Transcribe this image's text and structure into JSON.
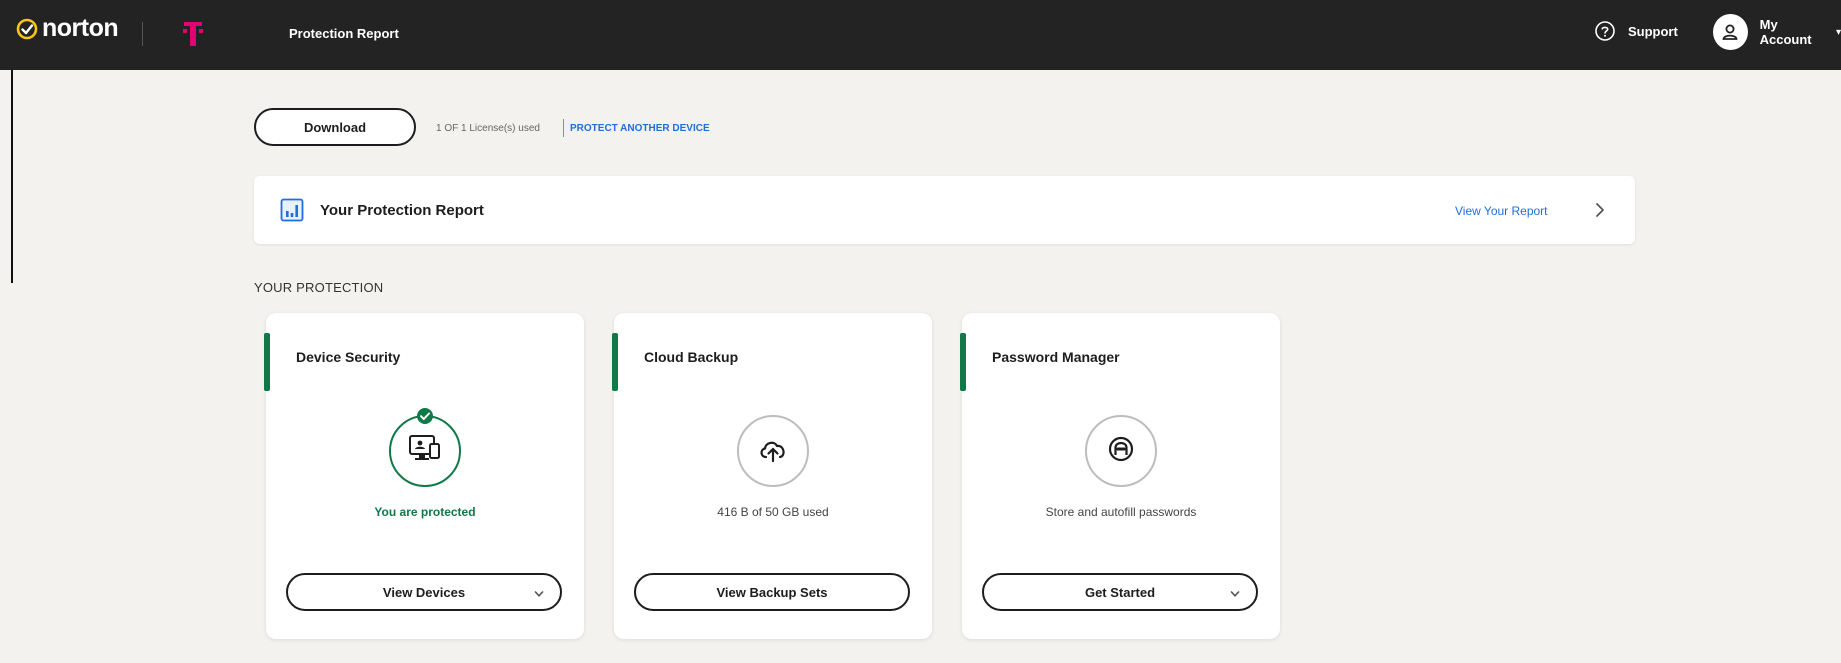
{
  "header": {
    "logo_text": "norton",
    "page_title": "Protection Report",
    "support_label": "Support",
    "account_label": "My Account",
    "brand_color": "#e20074"
  },
  "toolbar": {
    "download_label": "Download",
    "license_text": "1 OF 1 License(s) used",
    "protect_link": "PROTECT ANOTHER DEVICE"
  },
  "report": {
    "title": "Your Protection Report",
    "link_label": "View Your Report"
  },
  "section_label": "YOUR PROTECTION",
  "cards": [
    {
      "title": "Device Security",
      "icon": "monitor-device-icon",
      "status": "You are protected",
      "button_label": "View Devices",
      "has_dropdown": true
    },
    {
      "title": "Cloud Backup",
      "icon": "cloud-upload-icon",
      "status": "416 B of 50 GB used",
      "button_label": "View Backup Sets",
      "has_dropdown": false
    },
    {
      "title": "Password Manager",
      "icon": "password-vault-icon",
      "status": "Store and autofill passwords",
      "button_label": "Get Started",
      "has_dropdown": true
    }
  ],
  "colors": {
    "accent_green": "#0f7a47",
    "link_blue": "#1f6fd6",
    "topbar": "#232323",
    "background": "#f4f2ef"
  }
}
